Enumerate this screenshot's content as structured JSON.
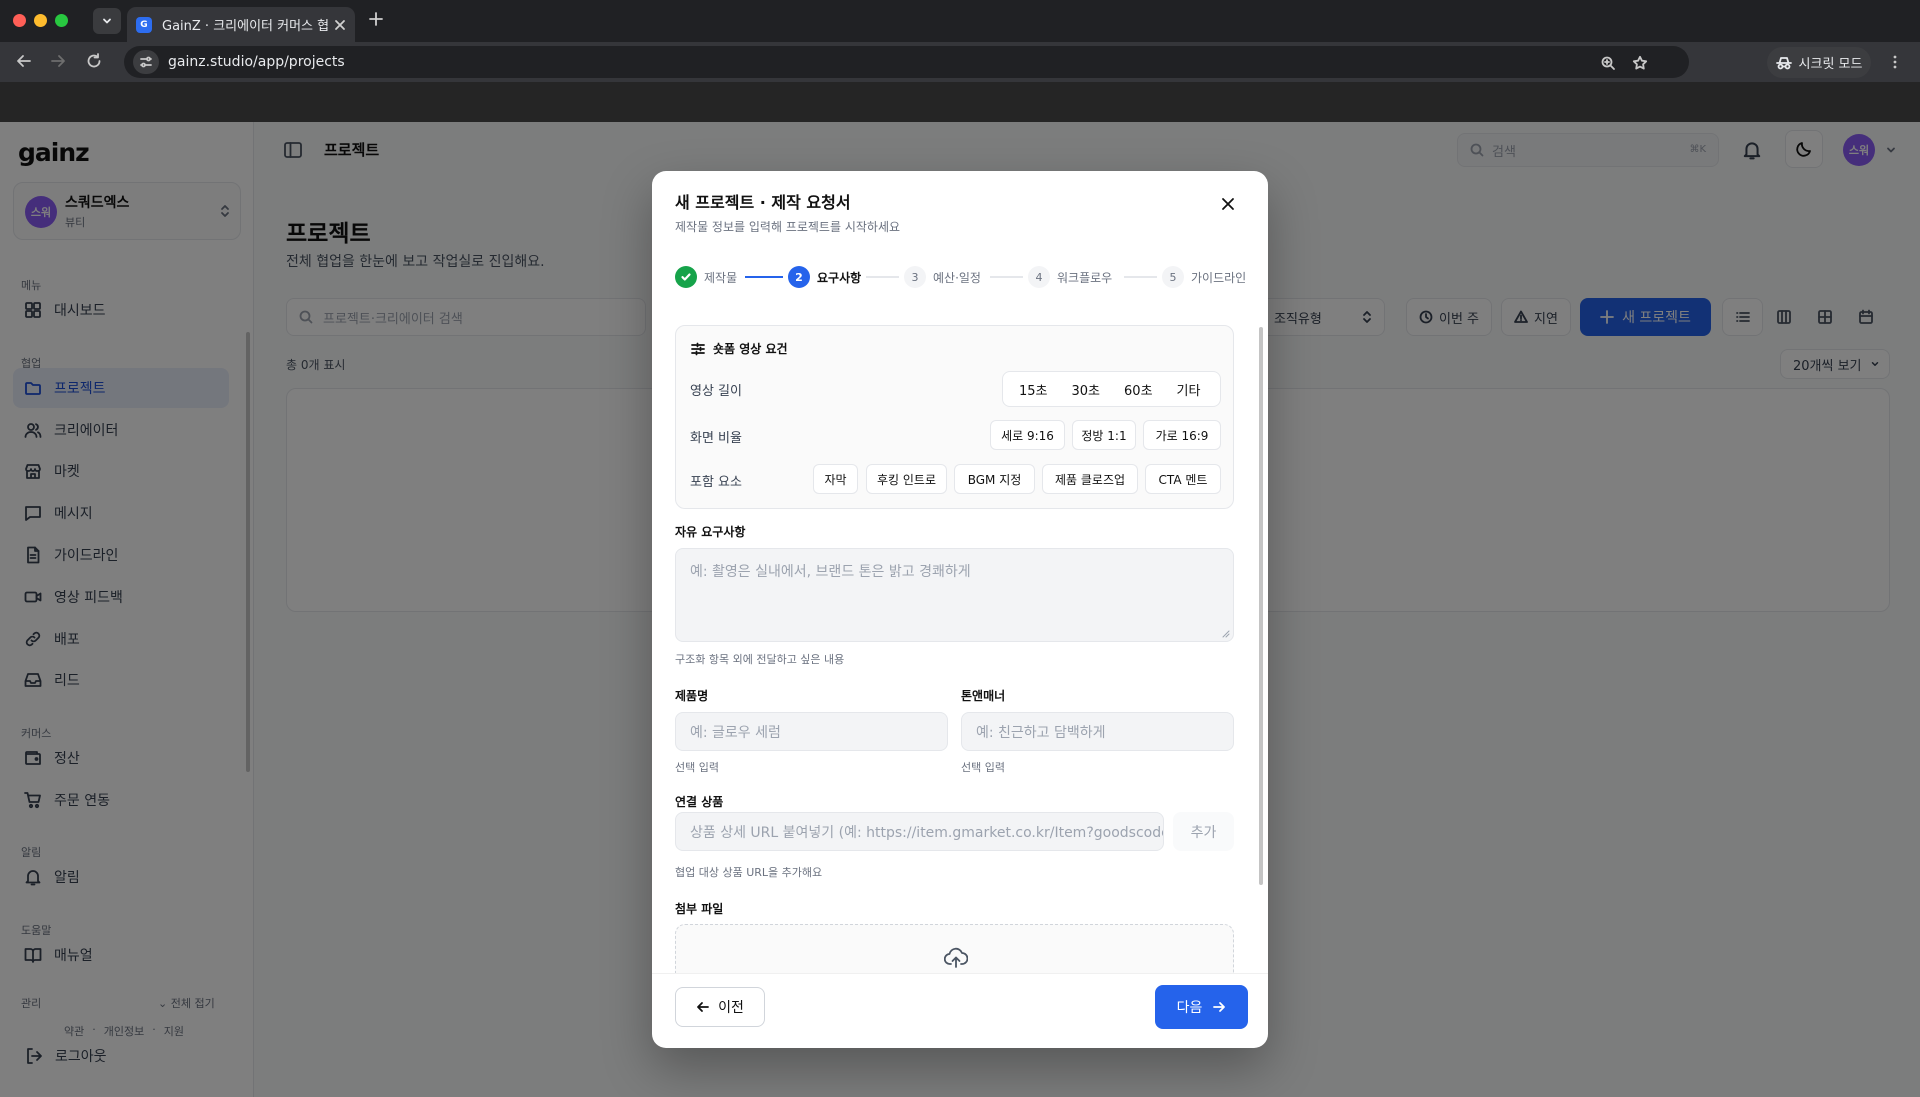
{
  "browser": {
    "tab_title": "GainZ · 크리에이터 커머스 협업 O",
    "favicon_letter": "G",
    "url": "gainz.studio/app/projects",
    "incognito_label": "시크릿 모드"
  },
  "sidebar": {
    "logo": "gainz",
    "workspace": {
      "avatar": "스워",
      "name": "스쿼드엑스",
      "sub": "뷰티"
    },
    "sections": {
      "menu": "메뉴",
      "collab": "협업",
      "commerce": "커머스",
      "alerts": "알림",
      "help": "도움말",
      "admin": "관리"
    },
    "items": {
      "dashboard": "대시보드",
      "projects": "프로젝트",
      "creators": "크리에이터",
      "market": "마켓",
      "messages": "메시지",
      "guidelines": "가이드라인",
      "video_feedback": "영상 피드백",
      "distribution": "배포",
      "leads": "리드",
      "settlement": "정산",
      "orders": "주문 연동",
      "notifications": "알림",
      "manual": "매뉴얼"
    },
    "collapse_all": "전체 접기",
    "footer_links": [
      "약관",
      "·",
      "개인정보",
      "·",
      "지원"
    ],
    "logout": "로그아웃"
  },
  "header": {
    "title": "프로젝트",
    "search_placeholder": "검색",
    "search_shortcut": "⌘K",
    "avatar": "스워"
  },
  "main": {
    "title": "프로젝트",
    "subtitle": "전체 협업을 한눈에 보고 작업실로 진입해요.",
    "search_placeholder": "프로젝트·크리에이터 검색",
    "filter_type": "조직유형",
    "filter_week": "이번 주",
    "filter_delay": "지연",
    "new_project": "새 프로젝트",
    "count_text": "총 0개 표시",
    "per_page": "20개씩 보기"
  },
  "modal": {
    "title": "새 프로젝트 · 제작 요청서",
    "subtitle": "제작물 정보를 입력해 프로젝트를 시작하세요",
    "steps": [
      {
        "num": "1",
        "label": "제작물",
        "status": "done"
      },
      {
        "num": "2",
        "label": "요구사항",
        "status": "current"
      },
      {
        "num": "3",
        "label": "예산·일정",
        "status": "todo"
      },
      {
        "num": "4",
        "label": "워크플로우",
        "status": "todo"
      },
      {
        "num": "5",
        "label": "가이드라인",
        "status": "todo"
      }
    ],
    "req_box_title": "숏폼 영상 요건",
    "length_label": "영상 길이",
    "length_options": [
      "15초",
      "30초",
      "60초",
      "기타"
    ],
    "ratio_label": "화면 비율",
    "ratio_options": [
      "세로 9:16",
      "정방 1:1",
      "가로 16:9"
    ],
    "elements_label": "포함 요소",
    "element_options": [
      "자막",
      "후킹 인트로",
      "BGM 지정",
      "제품 클로즈업",
      "CTA 멘트"
    ],
    "free_req_label": "자유 요구사항",
    "free_req_placeholder": "예: 촬영은 실내에서, 브랜드 톤은 밝고 경쾌하게",
    "free_req_help": "구조화 항목 외에 전달하고 싶은 내용",
    "product_label": "제품명",
    "product_placeholder": "예: 글로우 세럼",
    "product_help": "선택 입력",
    "tone_label": "톤앤매너",
    "tone_placeholder": "예: 친근하고 담백하게",
    "tone_help": "선택 입력",
    "linked_label": "연결 상품",
    "linked_placeholder": "상품 상세 URL 붙여넣기 (예: https://item.gmarket.co.kr/Item?goodscode=...)",
    "linked_add": "추가",
    "linked_help": "협업 대상 상품 URL을 추가해요",
    "attach_label": "첨부 파일",
    "prev": "이전",
    "next": "다음"
  },
  "colors": {
    "accent": "#2563eb",
    "done": "#16a34a",
    "avatar": "#8b5cf6"
  }
}
